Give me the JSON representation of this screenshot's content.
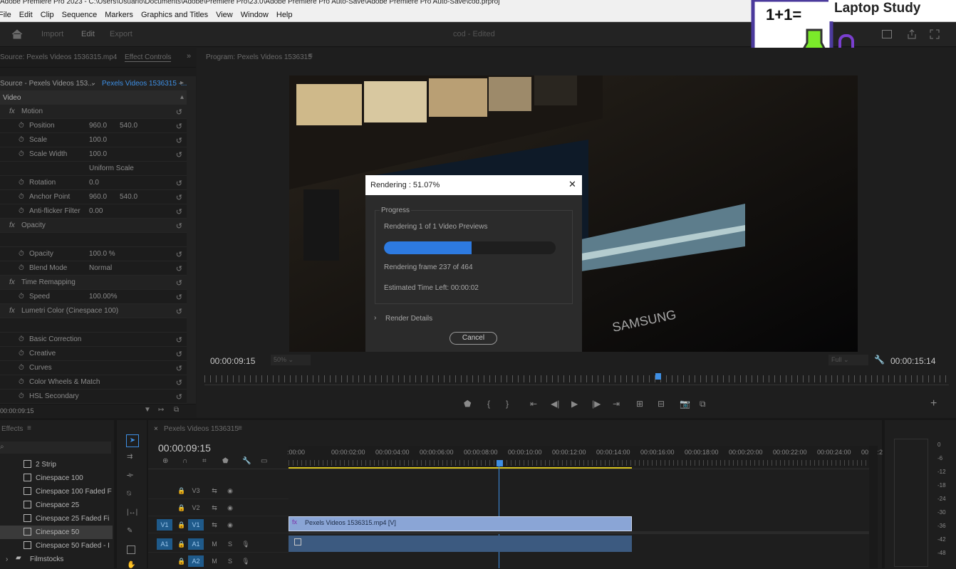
{
  "window": {
    "title_partial": "Adobe Premiere Pro 2023 - C:\\Users\\Usuario\\Documents\\Adobe\\Premiere Pro\\23.0\\Adobe Premiere Pro Auto-Save\\Adobe Premiere Pro Auto-Save\\cod.prproj"
  },
  "menu": [
    "File",
    "Edit",
    "Clip",
    "Sequence",
    "Markers",
    "Graphics and Titles",
    "View",
    "Window",
    "Help"
  ],
  "workspace": {
    "tabs": [
      "Import",
      "Edit",
      "Export"
    ],
    "active": "Edit",
    "project_title": "cod - Edited"
  },
  "logo": {
    "text": "Laptop Study",
    "formula": "1+1="
  },
  "source_panel": {
    "tab_source": "Source: Pexels Videos 1536315.mp4",
    "tab_effect_controls": "Effect Controls",
    "breadcrumb_source": "Source - Pexels Videos 153...",
    "breadcrumb_clip": "Pexels Videos 1536315 -...",
    "section_video": "Video",
    "rows": [
      {
        "fx": true,
        "label": "Motion",
        "v1": "",
        "v2": ""
      },
      {
        "fx": false,
        "label": "Position",
        "v1": "960.0",
        "v2": "540.0"
      },
      {
        "fx": false,
        "label": "Scale",
        "v1": "100.0",
        "v2": ""
      },
      {
        "fx": false,
        "label": "Scale Width",
        "v1": "100.0",
        "v2": ""
      },
      {
        "fx": false,
        "label": "",
        "v1": "Uniform Scale",
        "v2": ""
      },
      {
        "fx": false,
        "label": "Rotation",
        "v1": "0.0",
        "v2": ""
      },
      {
        "fx": false,
        "label": "Anchor Point",
        "v1": "960.0",
        "v2": "540.0"
      },
      {
        "fx": false,
        "label": "Anti-flicker Filter",
        "v1": "0.00",
        "v2": ""
      },
      {
        "fx": true,
        "label": "Opacity",
        "v1": "",
        "v2": ""
      },
      {
        "fx": false,
        "label": "",
        "v1": "",
        "v2": ""
      },
      {
        "fx": false,
        "label": "Opacity",
        "v1": "100.0 %",
        "v2": ""
      },
      {
        "fx": false,
        "label": "Blend Mode",
        "v1": "Normal",
        "v2": ""
      },
      {
        "fx": true,
        "label": "Time Remapping",
        "v1": "",
        "v2": ""
      },
      {
        "fx": false,
        "label": "Speed",
        "v1": "100.00%",
        "v2": ""
      },
      {
        "fx": true,
        "label": "Lumetri Color (Cinespace 100)",
        "v1": "",
        "v2": ""
      },
      {
        "fx": false,
        "label": "",
        "v1": "",
        "v2": ""
      },
      {
        "fx": false,
        "label": "Basic Correction",
        "v1": "",
        "v2": ""
      },
      {
        "fx": false,
        "label": "Creative",
        "v1": "",
        "v2": ""
      },
      {
        "fx": false,
        "label": "Curves",
        "v1": "",
        "v2": ""
      },
      {
        "fx": false,
        "label": "Color Wheels & Match",
        "v1": "",
        "v2": ""
      },
      {
        "fx": false,
        "label": "HSL Secondary",
        "v1": "",
        "v2": ""
      }
    ],
    "timecode": "00:00:09:15"
  },
  "program": {
    "title": "Program: Pexels Videos 1536315",
    "timecode_left": "00:00:09:15",
    "zoom": "50%",
    "quality": "Full",
    "timecode_right": "00:00:15:14",
    "brand": "SAMSUNG"
  },
  "render_dialog": {
    "title": "Rendering : 51.07%",
    "close": "✕",
    "progress_legend": "Progress",
    "status": "Rendering 1 of 1 Video Previews",
    "progress": 0.51,
    "frame_text": "Rendering frame 237 of 464",
    "eta_text": "Estimated Time Left: 00:00:02",
    "details": "Render Details",
    "cancel": "Cancel"
  },
  "effects_panel": {
    "title": "Effects",
    "items": [
      "2 Strip",
      "Cinespace 100",
      "Cinespace 100 Faded F",
      "Cinespace 25",
      "Cinespace 25 Faded Fi",
      "Cinespace 50",
      "Cinespace 50 Faded - I"
    ],
    "selected": "Cinespace 50",
    "folder": "Filmstocks"
  },
  "timeline": {
    "tab": "Pexels Videos 1536315",
    "timecode": "00:00:09:15",
    "ruler": [
      ":00:00",
      "00:00:02:00",
      "00:00:04:00",
      "00:00:06:00",
      "00:00:08:00",
      "00:00:10:00",
      "00:00:12:00",
      "00:00:14:00",
      "00:00:16:00",
      "00:00:18:00",
      "00:00:20:00",
      "00:00:22:00",
      "00:00:24:00",
      "00:00:2"
    ],
    "tracks": [
      {
        "name": "V3",
        "source": ""
      },
      {
        "name": "V2",
        "source": ""
      },
      {
        "name": "V1",
        "source": "V1"
      },
      {
        "name": "A1",
        "source": "A1"
      },
      {
        "name": "A2",
        "source": ""
      }
    ],
    "clip_label": "Pexels Videos 1536315.mp4 [V]",
    "track_buttons": {
      "mute": "M",
      "solo": "S"
    }
  },
  "meter_labels": [
    "0",
    "-6",
    "-12",
    "-18",
    "-24",
    "-30",
    "-36",
    "-42",
    "-48"
  ],
  "colors": {
    "accent": "#2d7ae0",
    "yellow_bar": "#d8c31e",
    "clip_video": "#8aa5d6",
    "clip_audio": "#3c5a80"
  }
}
